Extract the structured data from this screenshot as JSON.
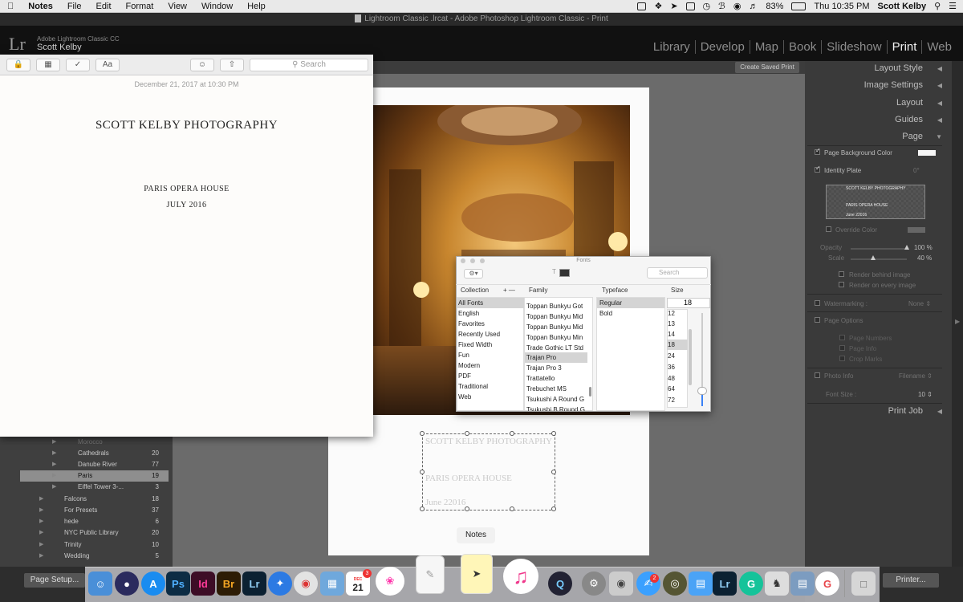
{
  "menubar": {
    "app": "Notes",
    "items": [
      "File",
      "Edit",
      "Format",
      "View",
      "Window",
      "Help"
    ],
    "battery": "83%",
    "clock": "Thu 10:35 PM",
    "user": "Scott Kelby"
  },
  "lightroom": {
    "window_title": "Lightroom Classic .lrcat - Adobe Photoshop Lightroom Classic - Print",
    "logo": "Lr",
    "product": "Adobe Lightroom Classic CC",
    "user": "Scott Kelby",
    "modules": [
      "Library",
      "Develop",
      "Map",
      "Book",
      "Slideshow",
      "Print",
      "Web"
    ],
    "active_module": "Print",
    "create_saved_print": "Create Saved Print",
    "page_setup": "Page Setup...",
    "printer": "Printer...",
    "collections": [
      {
        "name": "Morocco",
        "count": ""
      },
      {
        "name": "Cathedrals",
        "count": "20"
      },
      {
        "name": "Danube River",
        "count": "77"
      },
      {
        "name": "Paris",
        "count": "19"
      },
      {
        "name": "Eiffel Tower 3-...",
        "count": "3"
      },
      {
        "name": "Falcons",
        "count": "18"
      },
      {
        "name": "For Presets",
        "count": "37"
      },
      {
        "name": "hede",
        "count": "6"
      },
      {
        "name": "NYC Public Library",
        "count": "20"
      },
      {
        "name": "Trinity",
        "count": "10"
      },
      {
        "name": "Wedding",
        "count": "5"
      }
    ],
    "right_panel": {
      "layout_style": "Layout Style",
      "image_settings": "Image Settings",
      "layout": "Layout",
      "guides": "Guides",
      "page": "Page",
      "page_bg_color": "Page Background Color",
      "identity_plate": "Identity Plate",
      "identity_angle": "0°",
      "plate_preview_line1": "SCOTT KELBY PHOTOGRAPHY",
      "plate_preview_line2": "PARIS OPERA HOUSE",
      "plate_preview_line3": "June 22016",
      "override_color": "Override Color",
      "opacity_label": "Opacity",
      "opacity_value": "100",
      "opacity_unit": "%",
      "opacity_fraction": 1.0,
      "scale_label": "Scale",
      "scale_value": "40",
      "scale_unit": "%",
      "scale_fraction": 0.4,
      "render_behind": "Render behind image",
      "render_every": "Render on every image",
      "watermarking": "Watermarking :",
      "watermark_value": "None",
      "page_options": "Page Options",
      "page_numbers": "Page Numbers",
      "page_info": "Page Info",
      "crop_marks": "Crop Marks",
      "photo_info": "Photo Info",
      "photo_info_value": "Filename",
      "font_size_label": "Font Size :",
      "font_size_value": "10",
      "print_job": "Print Job"
    },
    "plate_on_page": {
      "line1": "SCOTT KELBY PHOTOGRAPHY",
      "line2": "PARIS OPERA HOUSE",
      "line3": "June 22016"
    }
  },
  "notes_window": {
    "search_placeholder": "Search",
    "date": "December 21, 2017 at 10:30 PM",
    "line1": "SCOTT KELBY PHOTOGRAPHY",
    "line2": "PARIS OPERA HOUSE",
    "line3": "JULY 2016",
    "format_button": "Aa"
  },
  "fonts_panel": {
    "title": "Fonts",
    "search_placeholder": "Search",
    "collection_header": "Collection",
    "family_header": "Family",
    "typeface_header": "Typeface",
    "size_header": "Size",
    "collections": [
      "All Fonts",
      "English",
      "Favorites",
      "Recently Used",
      "Fixed Width",
      "Fun",
      "Modern",
      "PDF",
      "Traditional",
      "Web"
    ],
    "families": [
      "Toppan Bunkyu Got",
      "Toppan Bunkyu Mid",
      "Toppan Bunkyu Mid",
      "Toppan Bunkyu Min",
      "Trade Gothic LT Std",
      "Trajan Pro",
      "Trajan Pro 3",
      "Trattatello",
      "Trebuchet MS",
      "Tsukushi A Round G",
      "Tsukushi B Round G"
    ],
    "typefaces": [
      "Regular",
      "Bold"
    ],
    "size_value": "18",
    "sizes": [
      "12",
      "13",
      "14",
      "18",
      "24",
      "36",
      "48",
      "64",
      "72"
    ]
  },
  "dock_tooltip": "Notes",
  "dock": {
    "calendar_day": "21",
    "calendar_month": "DEC",
    "calendar_badge": "3",
    "mail_badge": "2",
    "apps": [
      "Finder",
      "Siri",
      "App Store",
      "Ps",
      "Id",
      "Br",
      "Lr",
      "Safari",
      "Chrome",
      "Preview",
      "Calendar",
      "Photos",
      "TextEdit",
      "Notes",
      "iTunes",
      "QuickTime",
      "System Preferences",
      "Screenshot",
      "Messages",
      "Globe",
      "Keynote",
      "Lr",
      "Grammarly",
      "Chess",
      "Script",
      "Google",
      "Trash"
    ]
  }
}
